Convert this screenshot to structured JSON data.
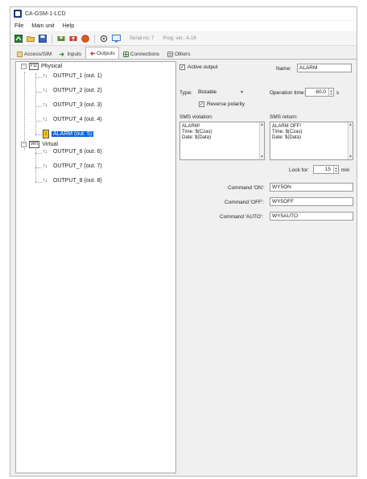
{
  "window": {
    "title": "CA-GSM-1-LCD"
  },
  "menu": [
    "File",
    "Main unit",
    "Help"
  ],
  "toolbar": {
    "serial_label": "Serial no: 7",
    "progver_label": "Prog. ver.: A-16"
  },
  "tabs": [
    {
      "label": "Access/SIM"
    },
    {
      "label": "Inputs"
    },
    {
      "label": "Outputs",
      "active": true
    },
    {
      "label": "Connections"
    },
    {
      "label": "Others"
    }
  ],
  "tree": {
    "physical": {
      "code": "Fiz",
      "label": "Physical"
    },
    "virtual": {
      "code": "Wrt",
      "label": "Virtual"
    },
    "outputs": [
      {
        "label": "OUTPUT_1 (out. 1)"
      },
      {
        "label": "OUTPUT_2 (out. 2)"
      },
      {
        "label": "OUTPUT_3 (out. 3)"
      },
      {
        "label": "OUTPUT_4 (out. 4)"
      },
      {
        "label": "ALARM (out. 5)",
        "selected": true
      },
      {
        "label": "OUTPUT_6 (out. 6)"
      },
      {
        "label": "OUTPUT_7 (out. 7)"
      },
      {
        "label": "OUTPUT_8 (out. 8)"
      }
    ]
  },
  "details": {
    "active_output_label": "Active output",
    "active_output_checked": true,
    "name_label": "Name:",
    "name_value": "ALARM",
    "type_label": "Type:",
    "type_value": "Bistable",
    "operation_time_label": "Operation time:",
    "operation_time_value": "60.0",
    "operation_time_unit": "s",
    "reverse_polarity_label": "Reverse polarity",
    "reverse_polarity_checked": true,
    "sms_violation_label": "SMS violation:",
    "sms_violation_lines": [
      "ALARM!",
      "Time: $(Czas)",
      "Date: $(Data)"
    ],
    "sms_return_label": "SMS return:",
    "sms_return_lines": [
      "ALARM OFF!",
      "Time: $(Czas)",
      "Date: $(Data)"
    ],
    "lock_for_label": "Lock for:",
    "lock_for_value": "15",
    "lock_for_unit": "min",
    "cmd_on_label": "Command 'ON':",
    "cmd_on_value": "WY5ON",
    "cmd_off_label": "Command 'OFF':",
    "cmd_off_value": "WY5OFF",
    "cmd_auto_label": "Command 'AUTO':",
    "cmd_auto_value": "WY5AUTO"
  },
  "colors": {
    "selection": "#0a63d6",
    "alarm_icon": "#f5c518"
  }
}
